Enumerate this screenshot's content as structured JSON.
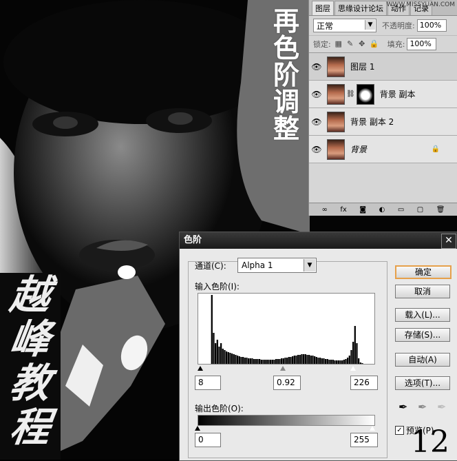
{
  "title_chars": [
    "再",
    "色",
    "阶",
    "调",
    "整"
  ],
  "calligraphy_chars": [
    "越",
    "峰",
    "教",
    "程"
  ],
  "layers_panel": {
    "tabs": [
      "图层",
      "思缘设计论坛",
      "动作",
      "记录"
    ],
    "watermark": "WWW.MISSYUAN.COM",
    "blend_mode": "正常",
    "opacity_label": "不透明度:",
    "opacity_value": "100%",
    "lock_label": "锁定:",
    "fill_label": "填充:",
    "fill_value": "100%",
    "layers": [
      {
        "name": "图层 1",
        "selected": true,
        "mask": false,
        "italic": false,
        "locked": false
      },
      {
        "name": "背景 副本",
        "selected": false,
        "mask": true,
        "italic": false,
        "locked": false
      },
      {
        "name": "背景 副本 2",
        "selected": false,
        "mask": false,
        "italic": false,
        "locked": false
      },
      {
        "name": "背景",
        "selected": false,
        "mask": false,
        "italic": true,
        "locked": true
      }
    ],
    "footer_icons": [
      "link-icon",
      "fx-icon",
      "mask-icon",
      "adjustment-icon",
      "folder-icon",
      "new-layer-icon",
      "trash-icon"
    ]
  },
  "levels_dialog": {
    "title": "色阶",
    "channel_label": "通道(C):",
    "channel_value": "Alpha 1",
    "input_label": "输入色阶(I):",
    "input_black": "8",
    "input_gamma": "0.92",
    "input_white": "226",
    "output_label": "输出色阶(O):",
    "output_black": "0",
    "output_white": "255",
    "buttons": {
      "ok": "确定",
      "cancel": "取消",
      "load": "载入(L)...",
      "save": "存储(S)...",
      "auto": "自动(A)",
      "options": "选项(T)..."
    },
    "preview_label": "预览(P)",
    "preview_checked": true
  },
  "step_number": "12",
  "histogram": [
    0,
    0,
    0,
    0,
    0,
    0,
    0,
    1.0,
    0.45,
    0.3,
    0.35,
    0.25,
    0.3,
    0.22,
    0.2,
    0.18,
    0.17,
    0.16,
    0.15,
    0.14,
    0.13,
    0.12,
    0.11,
    0.1,
    0.1,
    0.09,
    0.09,
    0.08,
    0.08,
    0.08,
    0.07,
    0.07,
    0.07,
    0.07,
    0.06,
    0.06,
    0.06,
    0.06,
    0.06,
    0.06,
    0.06,
    0.06,
    0.07,
    0.07,
    0.07,
    0.08,
    0.08,
    0.09,
    0.09,
    0.1,
    0.1,
    0.11,
    0.12,
    0.12,
    0.13,
    0.13,
    0.14,
    0.14,
    0.14,
    0.13,
    0.13,
    0.12,
    0.12,
    0.11,
    0.1,
    0.09,
    0.09,
    0.08,
    0.08,
    0.07,
    0.07,
    0.06,
    0.06,
    0.06,
    0.05,
    0.05,
    0.05,
    0.05,
    0.05,
    0.06,
    0.07,
    0.09,
    0.12,
    0.2,
    0.32,
    0.55,
    0.3,
    0.08,
    0.02,
    0.01,
    0,
    0,
    0,
    0,
    0,
    0
  ]
}
